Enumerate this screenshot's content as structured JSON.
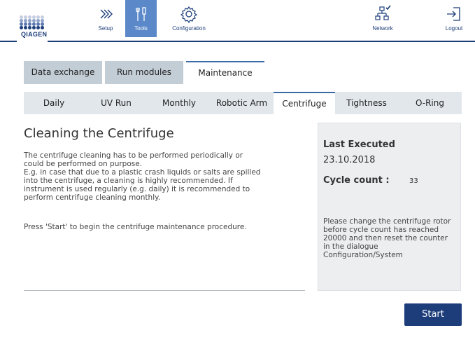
{
  "header": {
    "logo_text": "QIAGEN",
    "nav": {
      "setup": "Setup",
      "tools": "Tools",
      "configuration": "Configuration",
      "network": "Network",
      "logout": "Logout"
    }
  },
  "tabs_primary": [
    "Data exchange",
    "Run modules",
    "Maintenance"
  ],
  "tabs_secondary": [
    "Daily",
    "UV Run",
    "Monthly",
    "Robotic Arm",
    "Centrifuge",
    "Tightness",
    "O-Ring"
  ],
  "main": {
    "title": "Cleaning the Centrifuge",
    "description": "The centrifuge cleaning has to be performed periodically or\ncould be performed on purpose.\nE.g. in case that due to a plastic crash liquids or salts are spilled\ninto the centrifuge, a cleaning is highly recommended. If\ninstrument is used regularly (e.g. daily) it is recommended to\nperform centrifuge cleaning monthly.",
    "instruction": "Press 'Start' to begin the centrifuge maintenance procedure."
  },
  "panel": {
    "last_executed_label": "Last Executed",
    "last_executed_value": "23.10.2018",
    "cycle_count_label": "Cycle count :",
    "cycle_count_value": "33",
    "note": "Please change the centrifuge rotor before cycle count has reached 20000 and then reset the counter in the dialogue Configuration/System"
  },
  "actions": {
    "start_label": "Start"
  },
  "colors": {
    "brand": "#1c3d7a",
    "nav_active": "#5b88c9",
    "tab_inactive": "#c3cdd6",
    "tab_row2_bg": "#e2e7ec",
    "panel_bg": "#eceef0"
  }
}
